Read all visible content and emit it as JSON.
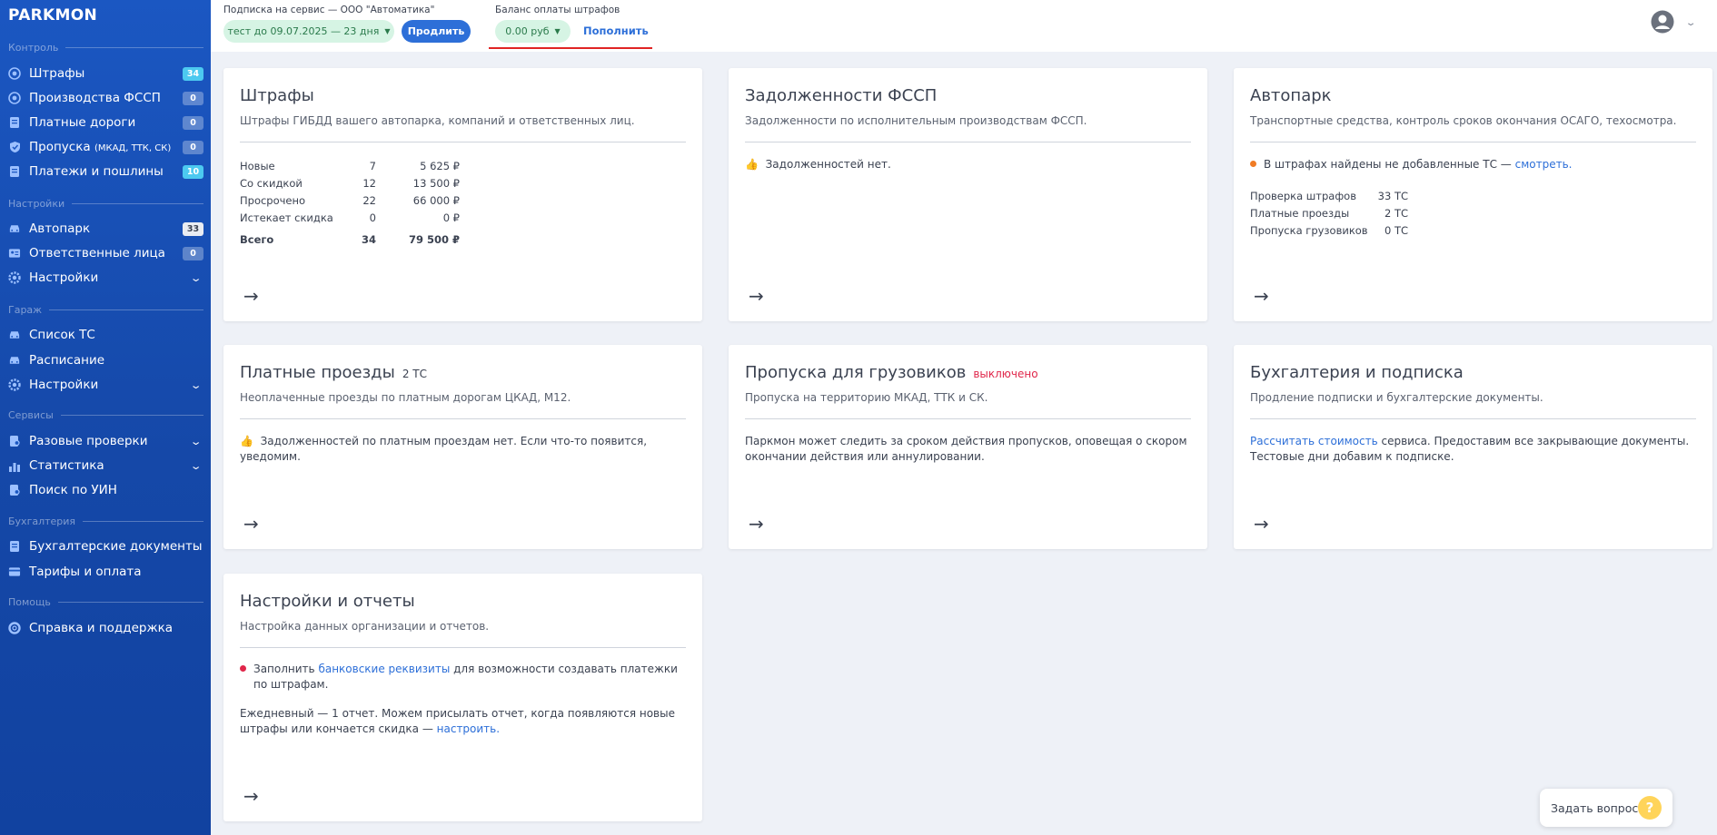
{
  "app": {
    "logo": "PARKMON"
  },
  "sidebar": {
    "sections": {
      "control": "Контроль",
      "settings": "Настройки",
      "garage": "Гараж",
      "services": "Сервисы",
      "accounting": "Бухгалтерия",
      "help": "Помощь"
    },
    "items": {
      "fines": {
        "label": "Штрафы",
        "badge": "34",
        "icon": "shield-icon"
      },
      "fssp": {
        "label": "Производства ФССП",
        "badge": "0",
        "icon": "shield-icon"
      },
      "roads": {
        "label": "Платные дороги",
        "badge": "0",
        "icon": "document-icon"
      },
      "passes": {
        "label": "Пропуска",
        "sublabel": "(МКАД, ТТК, СК)",
        "badge": "0",
        "icon": "shield-check-icon"
      },
      "payments": {
        "label": "Платежи и пошлины",
        "badge": "10",
        "icon": "document-icon"
      },
      "fleet": {
        "label": "Автопарк",
        "badge": "33",
        "icon": "car-icon"
      },
      "persons": {
        "label": "Ответственные лица",
        "badge": "0",
        "icon": "id-card-icon"
      },
      "settings1": {
        "label": "Настройки",
        "icon": "gear-icon"
      },
      "vehicles": {
        "label": "Список ТС",
        "icon": "car-icon"
      },
      "schedule": {
        "label": "Расписание",
        "icon": "car-icon"
      },
      "settings2": {
        "label": "Настройки",
        "icon": "gear-icon"
      },
      "checks": {
        "label": "Разовые проверки",
        "icon": "document-search-icon"
      },
      "stats": {
        "label": "Статистика",
        "icon": "chart-icon"
      },
      "uin": {
        "label": "Поиск по УИН",
        "icon": "search-doc-icon"
      },
      "docs": {
        "label": "Бухгалтерские документы",
        "icon": "document-icon"
      },
      "tariffs": {
        "label": "Тарифы и оплата",
        "icon": "card-icon"
      },
      "support": {
        "label": "Справка и поддержка",
        "icon": "lifebuoy-icon"
      }
    }
  },
  "topbar": {
    "subscription_label": "Подписка на сервис — ООО \"Автоматика\"",
    "subscription_value": "тест до 09.07.2025 — 23 дня",
    "extend_button": "Продлить",
    "balance_label": "Баланс оплаты штрафов",
    "balance_value": "0.00 руб",
    "topup_link": "Пополнить"
  },
  "cards": {
    "fines": {
      "title": "Штрафы",
      "desc": "Штрафы ГИБДД вашего автопарка, компаний и ответственных лиц.",
      "rows": [
        {
          "name": "Новые",
          "count": "7",
          "sum": "5 625 ₽"
        },
        {
          "name": "Со скидкой",
          "count": "12",
          "sum": "13 500 ₽"
        },
        {
          "name": "Просрочено",
          "count": "22",
          "sum": "66 000 ₽"
        },
        {
          "name": "Истекает скидка",
          "count": "0",
          "sum": "0 ₽"
        }
      ],
      "total": {
        "name": "Всего",
        "count": "34",
        "sum": "79 500 ₽"
      }
    },
    "fssp": {
      "title": "Задолженности ФССП",
      "desc": "Задолженности по исполнительным производствам ФССП.",
      "status": "Задолженностей нет."
    },
    "fleet": {
      "title": "Автопарк",
      "desc": "Транспортные средства, контроль сроков окончания ОСАГО, техосмотра.",
      "notice": "В штрафах найдены не добавленные ТС —",
      "notice_link": "смотреть.",
      "rows": [
        {
          "name": "Проверка штрафов",
          "value": "33 ТС"
        },
        {
          "name": "Платные проезды",
          "value": "2 ТС"
        },
        {
          "name": "Пропуска грузовиков",
          "value": "0 ТС"
        }
      ]
    },
    "roads": {
      "title": "Платные проезды",
      "tag": "2 ТС",
      "desc": "Неоплаченные проезды по платным дорогам ЦКАД, М12.",
      "status": "Задолженностей по платным проездам нет. Если что-то появится, уведомим."
    },
    "trucks": {
      "title": "Пропуска для грузовиков",
      "tag": "выключено",
      "desc": "Пропуска на территорию МКАД, ТТК и СК.",
      "text": "Паркмон может следить за сроком действия пропусков, оповещая о скором окончании действия или аннулировании."
    },
    "accounting": {
      "title": "Бухгалтерия и подписка",
      "desc": "Продление подписки и бухгалтерские документы.",
      "link": "Рассчитать стоимость",
      "text": " сервиса. Предоставим все закрывающие документы. Тестовые дни добавим к подписке."
    },
    "settings": {
      "title": "Настройки и отчеты",
      "desc": "Настройка данных организации и отчетов.",
      "item_pre": "Заполнить ",
      "item_link": "банковские реквизиты",
      "item_post": " для возможности создавать платежки по штрафам.",
      "report_text": "Ежедневный — 1 отчет. Можем присылать отчет, когда появляются новые штрафы или кончается скидка — ",
      "report_link": "настроить."
    },
    "arrow": "→"
  },
  "help_button": {
    "label": "Задать вопрос",
    "icon": "?"
  }
}
